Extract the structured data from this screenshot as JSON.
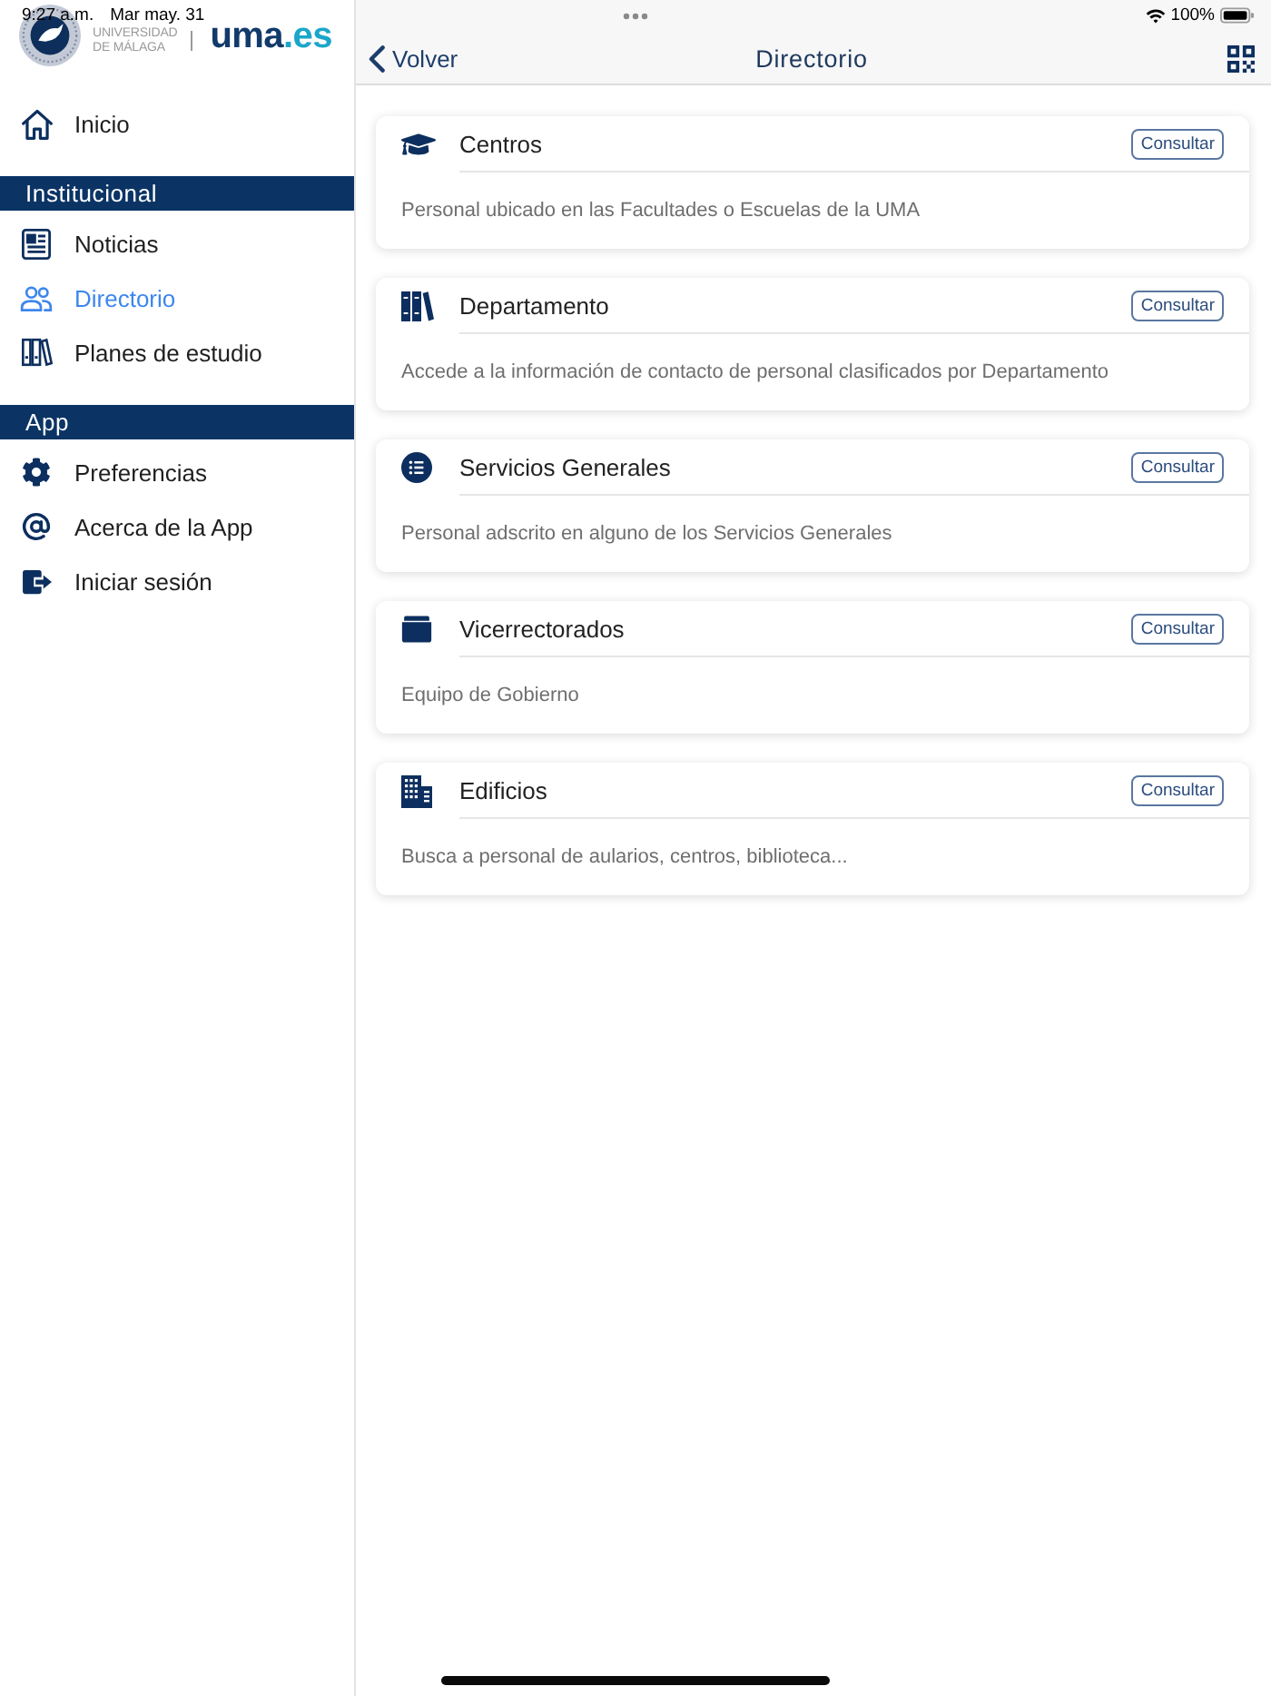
{
  "status_bar": {
    "time": "9:27 a.m.",
    "date": "Mar may. 31",
    "battery": "100%"
  },
  "sidebar": {
    "logo": {
      "name_lines": [
        "UNIVERSIDAD",
        "DE MÁLAGA"
      ],
      "brand": "uma",
      "brand_suffix": ".es"
    },
    "items": [
      {
        "label": "Inicio",
        "selected": false
      }
    ],
    "sections": [
      {
        "title": "Institucional",
        "items": [
          {
            "label": "Noticias",
            "selected": false
          },
          {
            "label": "Directorio",
            "selected": true
          },
          {
            "label": "Planes de estudio",
            "selected": false
          }
        ]
      },
      {
        "title": "App",
        "items": [
          {
            "label": "Preferencias",
            "selected": false
          },
          {
            "label": "Acerca de la App",
            "selected": false
          },
          {
            "label": "Iniciar sesión",
            "selected": false
          }
        ]
      }
    ]
  },
  "navbar": {
    "back": "Volver",
    "title": "Directorio"
  },
  "cards": [
    {
      "title": "Centros",
      "button": "Consultar",
      "description": "Personal ubicado en las Facultades o Escuelas de la UMA"
    },
    {
      "title": "Departamento",
      "button": "Consultar",
      "description": "Accede a la información de contacto de personal clasificados por Departamento"
    },
    {
      "title": "Servicios Generales",
      "button": "Consultar",
      "description": "Personal adscrito en alguno de los Servicios Generales"
    },
    {
      "title": "Vicerrectorados",
      "button": "Consultar",
      "description": "Equipo de Gobierno"
    },
    {
      "title": "Edificios",
      "button": "Consultar",
      "description": "Busca a personal de aularios, centros, biblioteca..."
    }
  ]
}
